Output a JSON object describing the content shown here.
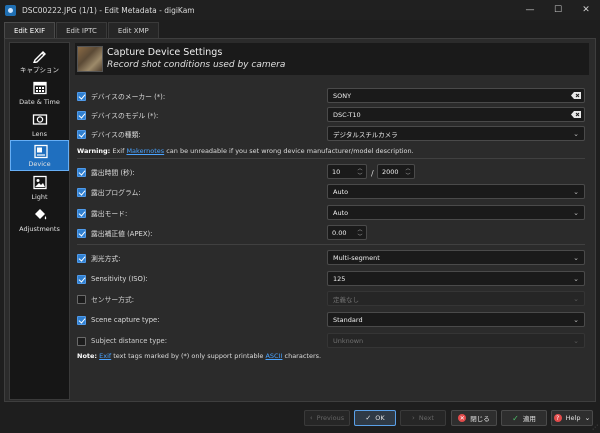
{
  "window": {
    "title": "DSC00222.JPG (1/1) - Edit Metadata - digiKam",
    "controls": {
      "minimize": "—",
      "maximize": "☐",
      "close": "✕"
    }
  },
  "tabs": [
    {
      "label": "Edit EXIF",
      "active": true
    },
    {
      "label": "Edit IPTC",
      "active": false
    },
    {
      "label": "Edit XMP",
      "active": false
    }
  ],
  "sidebar": {
    "items": [
      {
        "label": "キャプション",
        "icon": "pen-icon",
        "active": false
      },
      {
        "label": "Date & Time",
        "icon": "calendar-icon",
        "active": false
      },
      {
        "label": "Lens",
        "icon": "lens-icon",
        "active": false
      },
      {
        "label": "Device",
        "icon": "device-icon",
        "active": true
      },
      {
        "label": "Light",
        "icon": "image-icon",
        "active": false
      },
      {
        "label": "Adjustments",
        "icon": "paint-bucket-icon",
        "active": false
      }
    ]
  },
  "header": {
    "title": "Capture Device Settings",
    "subtitle": "Record shot conditions used by camera"
  },
  "fields": {
    "make": {
      "label": "デバイスのメーカー (*):",
      "value": "SONY",
      "checked": true
    },
    "model": {
      "label": "デバイスのモデル (*):",
      "value": "DSC-T10",
      "checked": true
    },
    "type": {
      "label": "デバイスの種類:",
      "value": "デジタルスチルカメラ",
      "checked": true
    },
    "exposure_time": {
      "label": "露出時間 (秒):",
      "numerator": "10",
      "separator": "/",
      "denominator": "2000",
      "checked": true
    },
    "exposure_program": {
      "label": "露出プログラム:",
      "value": "Auto",
      "checked": true
    },
    "exposure_mode": {
      "label": "露出モード:",
      "value": "Auto",
      "checked": true
    },
    "exposure_bias": {
      "label": "露出補正値 (APEX):",
      "value": "0.00",
      "checked": true
    },
    "metering_mode": {
      "label": "測光方式:",
      "value": "Multi-segment",
      "checked": true
    },
    "sensitivity": {
      "label": "Sensitivity (ISO):",
      "value": "125",
      "checked": true
    },
    "sensor_type": {
      "label": "センサー方式:",
      "value": "定義なし",
      "checked": false
    },
    "scene_capture": {
      "label": "Scene capture type:",
      "value": "Standard",
      "checked": true
    },
    "subject_distance": {
      "label": "Subject distance type:",
      "value": "Unknown",
      "checked": false
    }
  },
  "warning": {
    "prefix": "Warning:",
    "text1": " Exif ",
    "link": "Makernotes",
    "text2": " can be unreadable if you set wrong device manufacturer/model description."
  },
  "note": {
    "prefix": "Note:",
    "link1": "Exif",
    "text1": " text tags marked by (*) only support printable ",
    "link2": "ASCII",
    "text2": " characters."
  },
  "buttons": {
    "previous": "Previous",
    "ok": "OK",
    "next": "Next",
    "close": "閉じる",
    "apply": "適用",
    "help": "Help"
  }
}
